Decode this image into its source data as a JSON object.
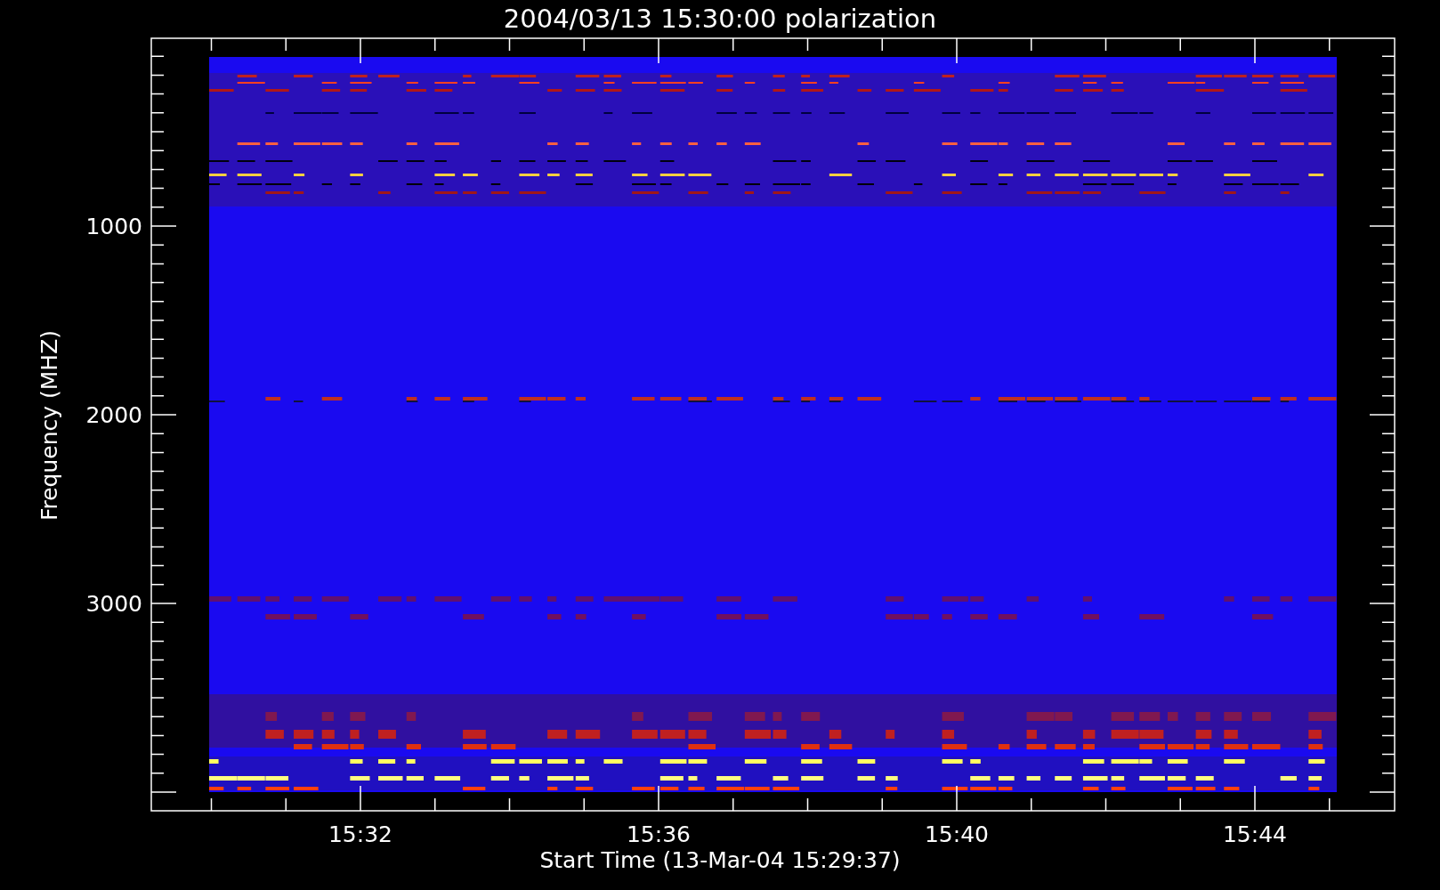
{
  "title": "2004/03/13 15:30:00 polarization",
  "y_axis": {
    "label": "Frequency (MHZ)",
    "ticks": [
      "1000",
      "2000",
      "3000"
    ]
  },
  "x_axis": {
    "label": "Start Time (13-Mar-04 15:29:37)",
    "ticks": [
      "15:32",
      "15:36",
      "15:40",
      "15:44"
    ]
  }
}
